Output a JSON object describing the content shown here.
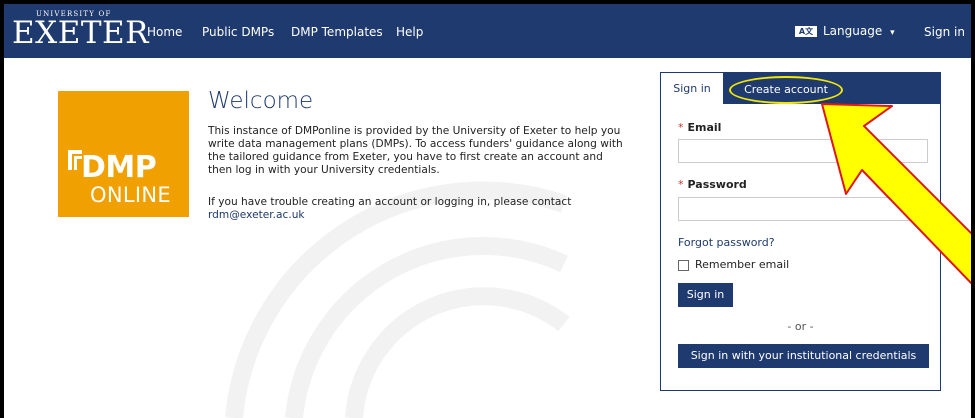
{
  "nav": {
    "logo_top": "UNIVERSITY OF",
    "logo_main": "EXETER",
    "links": [
      "Home",
      "Public DMPs",
      "DMP Templates",
      "Help"
    ],
    "language_icon": "A文",
    "language": "Language",
    "language_caret": "▾",
    "sign_in": "Sign in"
  },
  "logo_tile": {
    "dmp": "DMP",
    "online": "ONLINE",
    "color": "#f0a000"
  },
  "welcome": {
    "title": "Welcome",
    "para1_lines": [
      "This instance of DMPonline is provided by the University of Exeter to help you",
      "write data management plans (DMPs). To access funders' guidance along with",
      "the tailored guidance from Exeter, you have to first create an account and",
      "then log in with your University credentials."
    ],
    "para2_line1": "If you have trouble creating an account or logging in, please contact",
    "para2_email": "rdm@exeter.ac.uk"
  },
  "login": {
    "tab_signin": "Sign in",
    "tab_create": "Create account",
    "email_label": "Email",
    "email_value": "",
    "password_label": "Password",
    "password_value": "",
    "required_mark": "*",
    "forgot": "Forgot password?",
    "remember": "Remember email",
    "signin_button": "Sign in",
    "or": "- or -",
    "institutional_button": "Sign in with your institutional credentials"
  },
  "colors": {
    "navy": "#1e3a6e",
    "highlight": "#f3e600",
    "arrow_fill": "#ffff00",
    "arrow_stroke": "#e0161b"
  }
}
